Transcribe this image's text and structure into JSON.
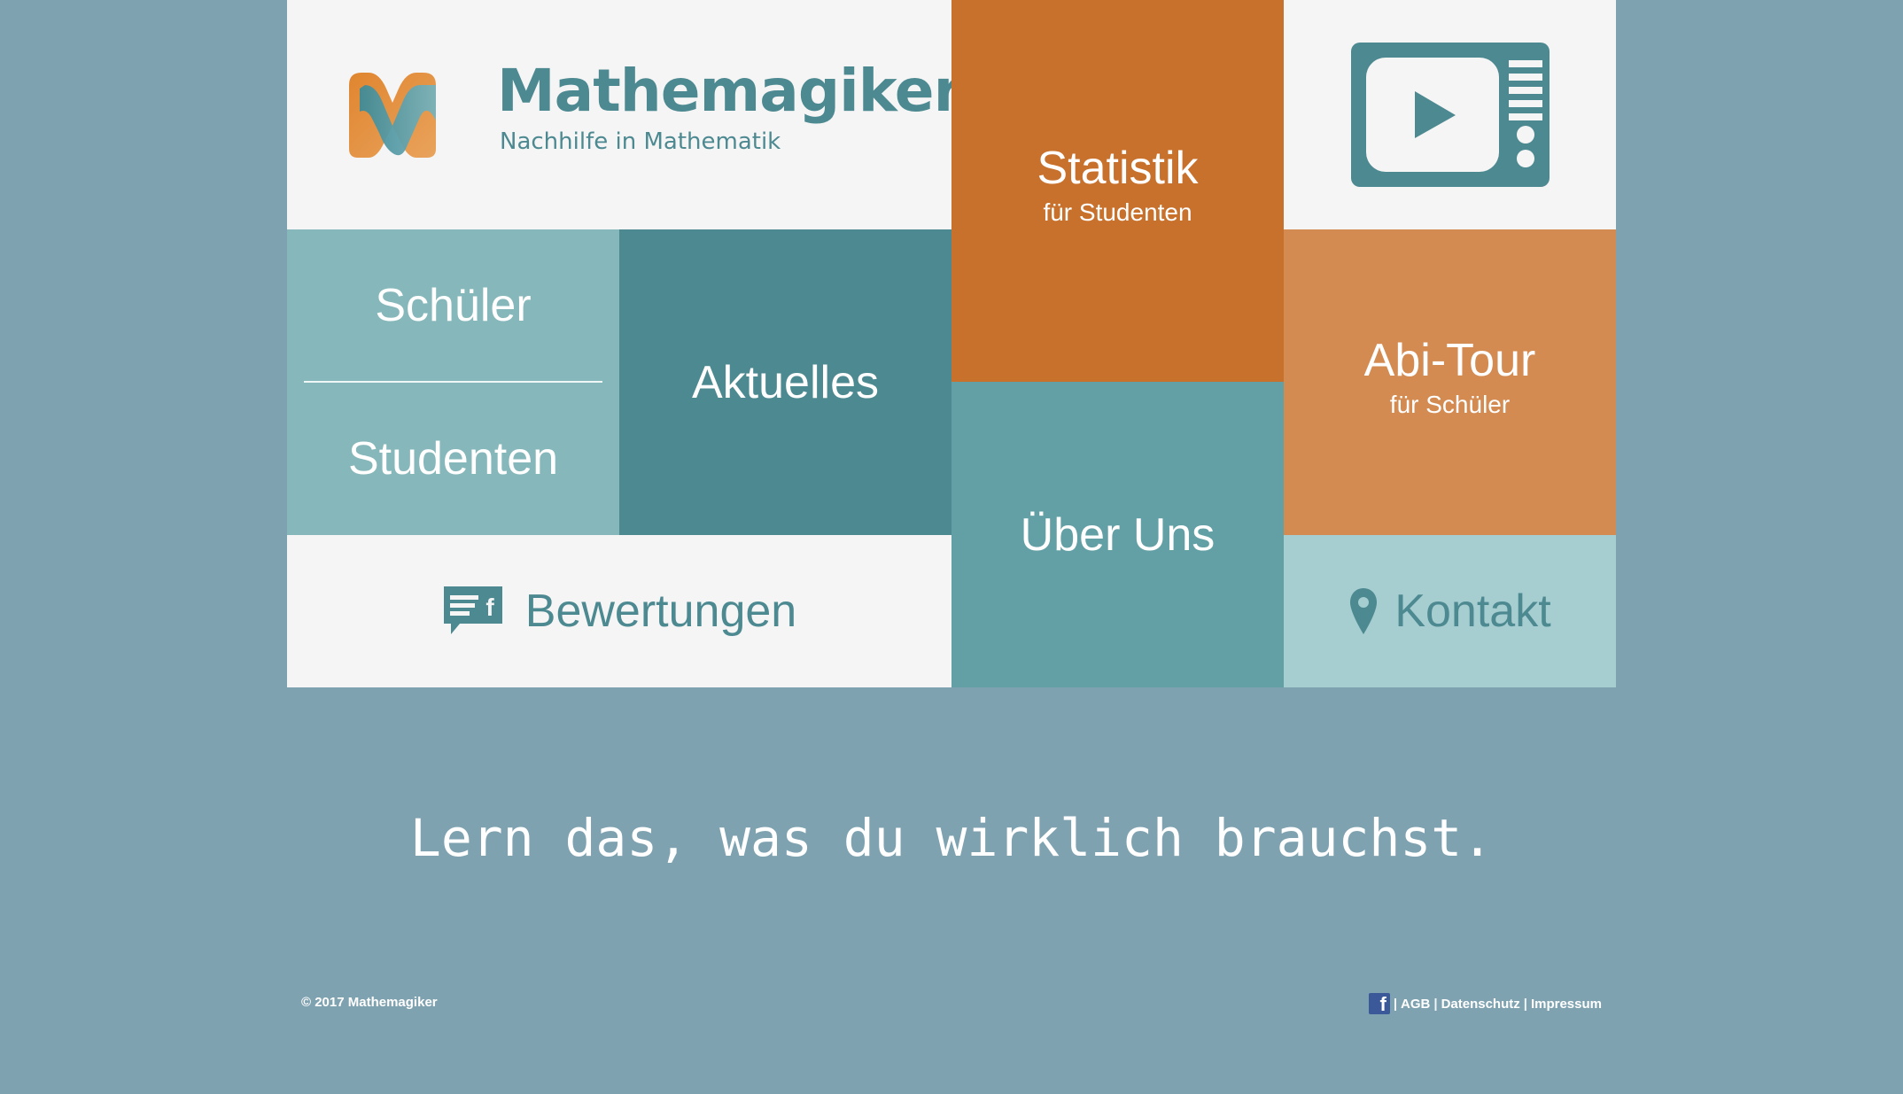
{
  "brand": {
    "title": "Mathemagiker",
    "subtitle": "Nachhilfe in Mathematik",
    "logo_icon": "mathemagiker-logo"
  },
  "tiles": {
    "statistik": {
      "title": "Statistik",
      "subtitle": "für Studenten"
    },
    "video": {
      "icon": "tv-play-icon"
    },
    "schueler": "Schüler",
    "studenten": "Studenten",
    "aktuelles": "Aktuelles",
    "ueber_uns": "Über Uns",
    "abitour": {
      "title": "Abi-Tour",
      "subtitle": "für Schüler"
    },
    "bewertungen": {
      "label": "Bewertungen",
      "icon": "facebook-review-icon"
    },
    "kontakt": {
      "label": "Kontakt",
      "icon": "map-pin-icon"
    }
  },
  "tagline": "Lern das, was du wirklich brauchst.",
  "footer": {
    "copyright": "© 2017 Mathemagiker",
    "links": [
      "AGB",
      "Datenschutz",
      "Impressum"
    ],
    "separator": "|"
  },
  "colors": {
    "background": "#7fa2b1",
    "orange_dark": "#c8712d",
    "orange_light": "#d38b52",
    "teal_dark": "#4d8991",
    "teal_mid": "#63a0a6",
    "teal_light": "#86b7ba",
    "teal_pale": "#a6cdd0",
    "tile_white": "#f5f5f5"
  }
}
